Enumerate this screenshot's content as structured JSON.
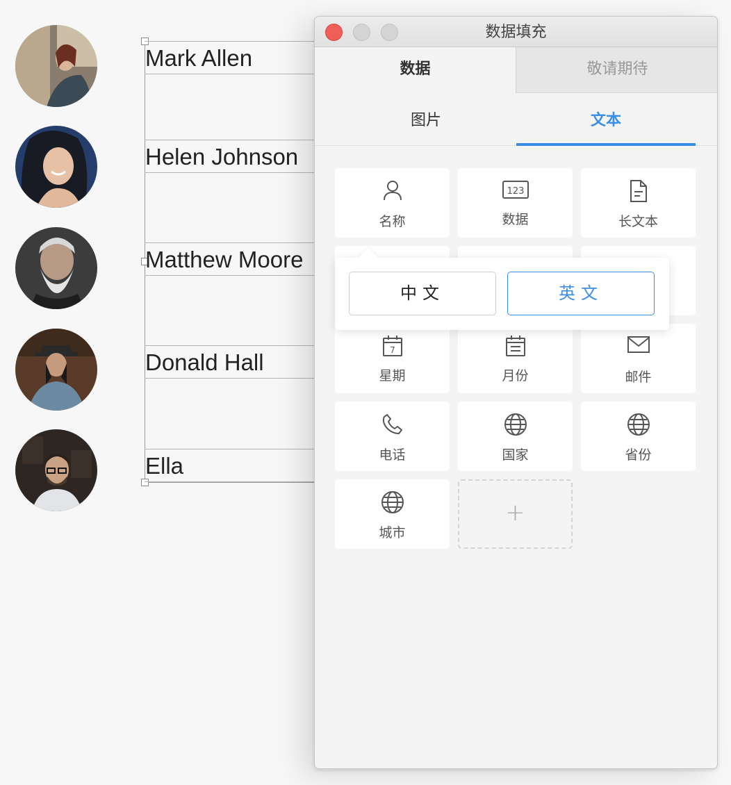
{
  "layer_names": [
    {
      "text": "Mark Allen"
    },
    {
      "text": "Helen Johnson"
    },
    {
      "text": "Matthew Moore"
    },
    {
      "text": "Donald Hall"
    },
    {
      "text": "Ella"
    }
  ],
  "window": {
    "title": "数据填充",
    "tabs": [
      "数据",
      "敬请期待"
    ],
    "sub_tabs": [
      "图片",
      "文本"
    ],
    "active_sub_tab": "文本",
    "items": [
      {
        "label": "名称",
        "icon": "person-icon"
      },
      {
        "label": "数据",
        "icon": "number-123-icon"
      },
      {
        "label": "长文本",
        "icon": "document-icon"
      },
      {
        "label": "星期",
        "icon": "calendar-day-icon"
      },
      {
        "label": "月份",
        "icon": "calendar-icon"
      },
      {
        "label": "邮件",
        "icon": "mail-icon"
      },
      {
        "label": "电话",
        "icon": "phone-icon"
      },
      {
        "label": "国家",
        "icon": "globe-icon"
      },
      {
        "label": "省份",
        "icon": "globe-icon"
      },
      {
        "label": "城市",
        "icon": "globe-icon"
      }
    ],
    "add_symbol": "+",
    "calendar_day": "7",
    "number_icon_text": "123",
    "popup": {
      "options": [
        "中文",
        "英文"
      ],
      "selected": "英文"
    }
  },
  "colors": {
    "accent": "#3a8ee6",
    "close": "#ee5f57"
  }
}
